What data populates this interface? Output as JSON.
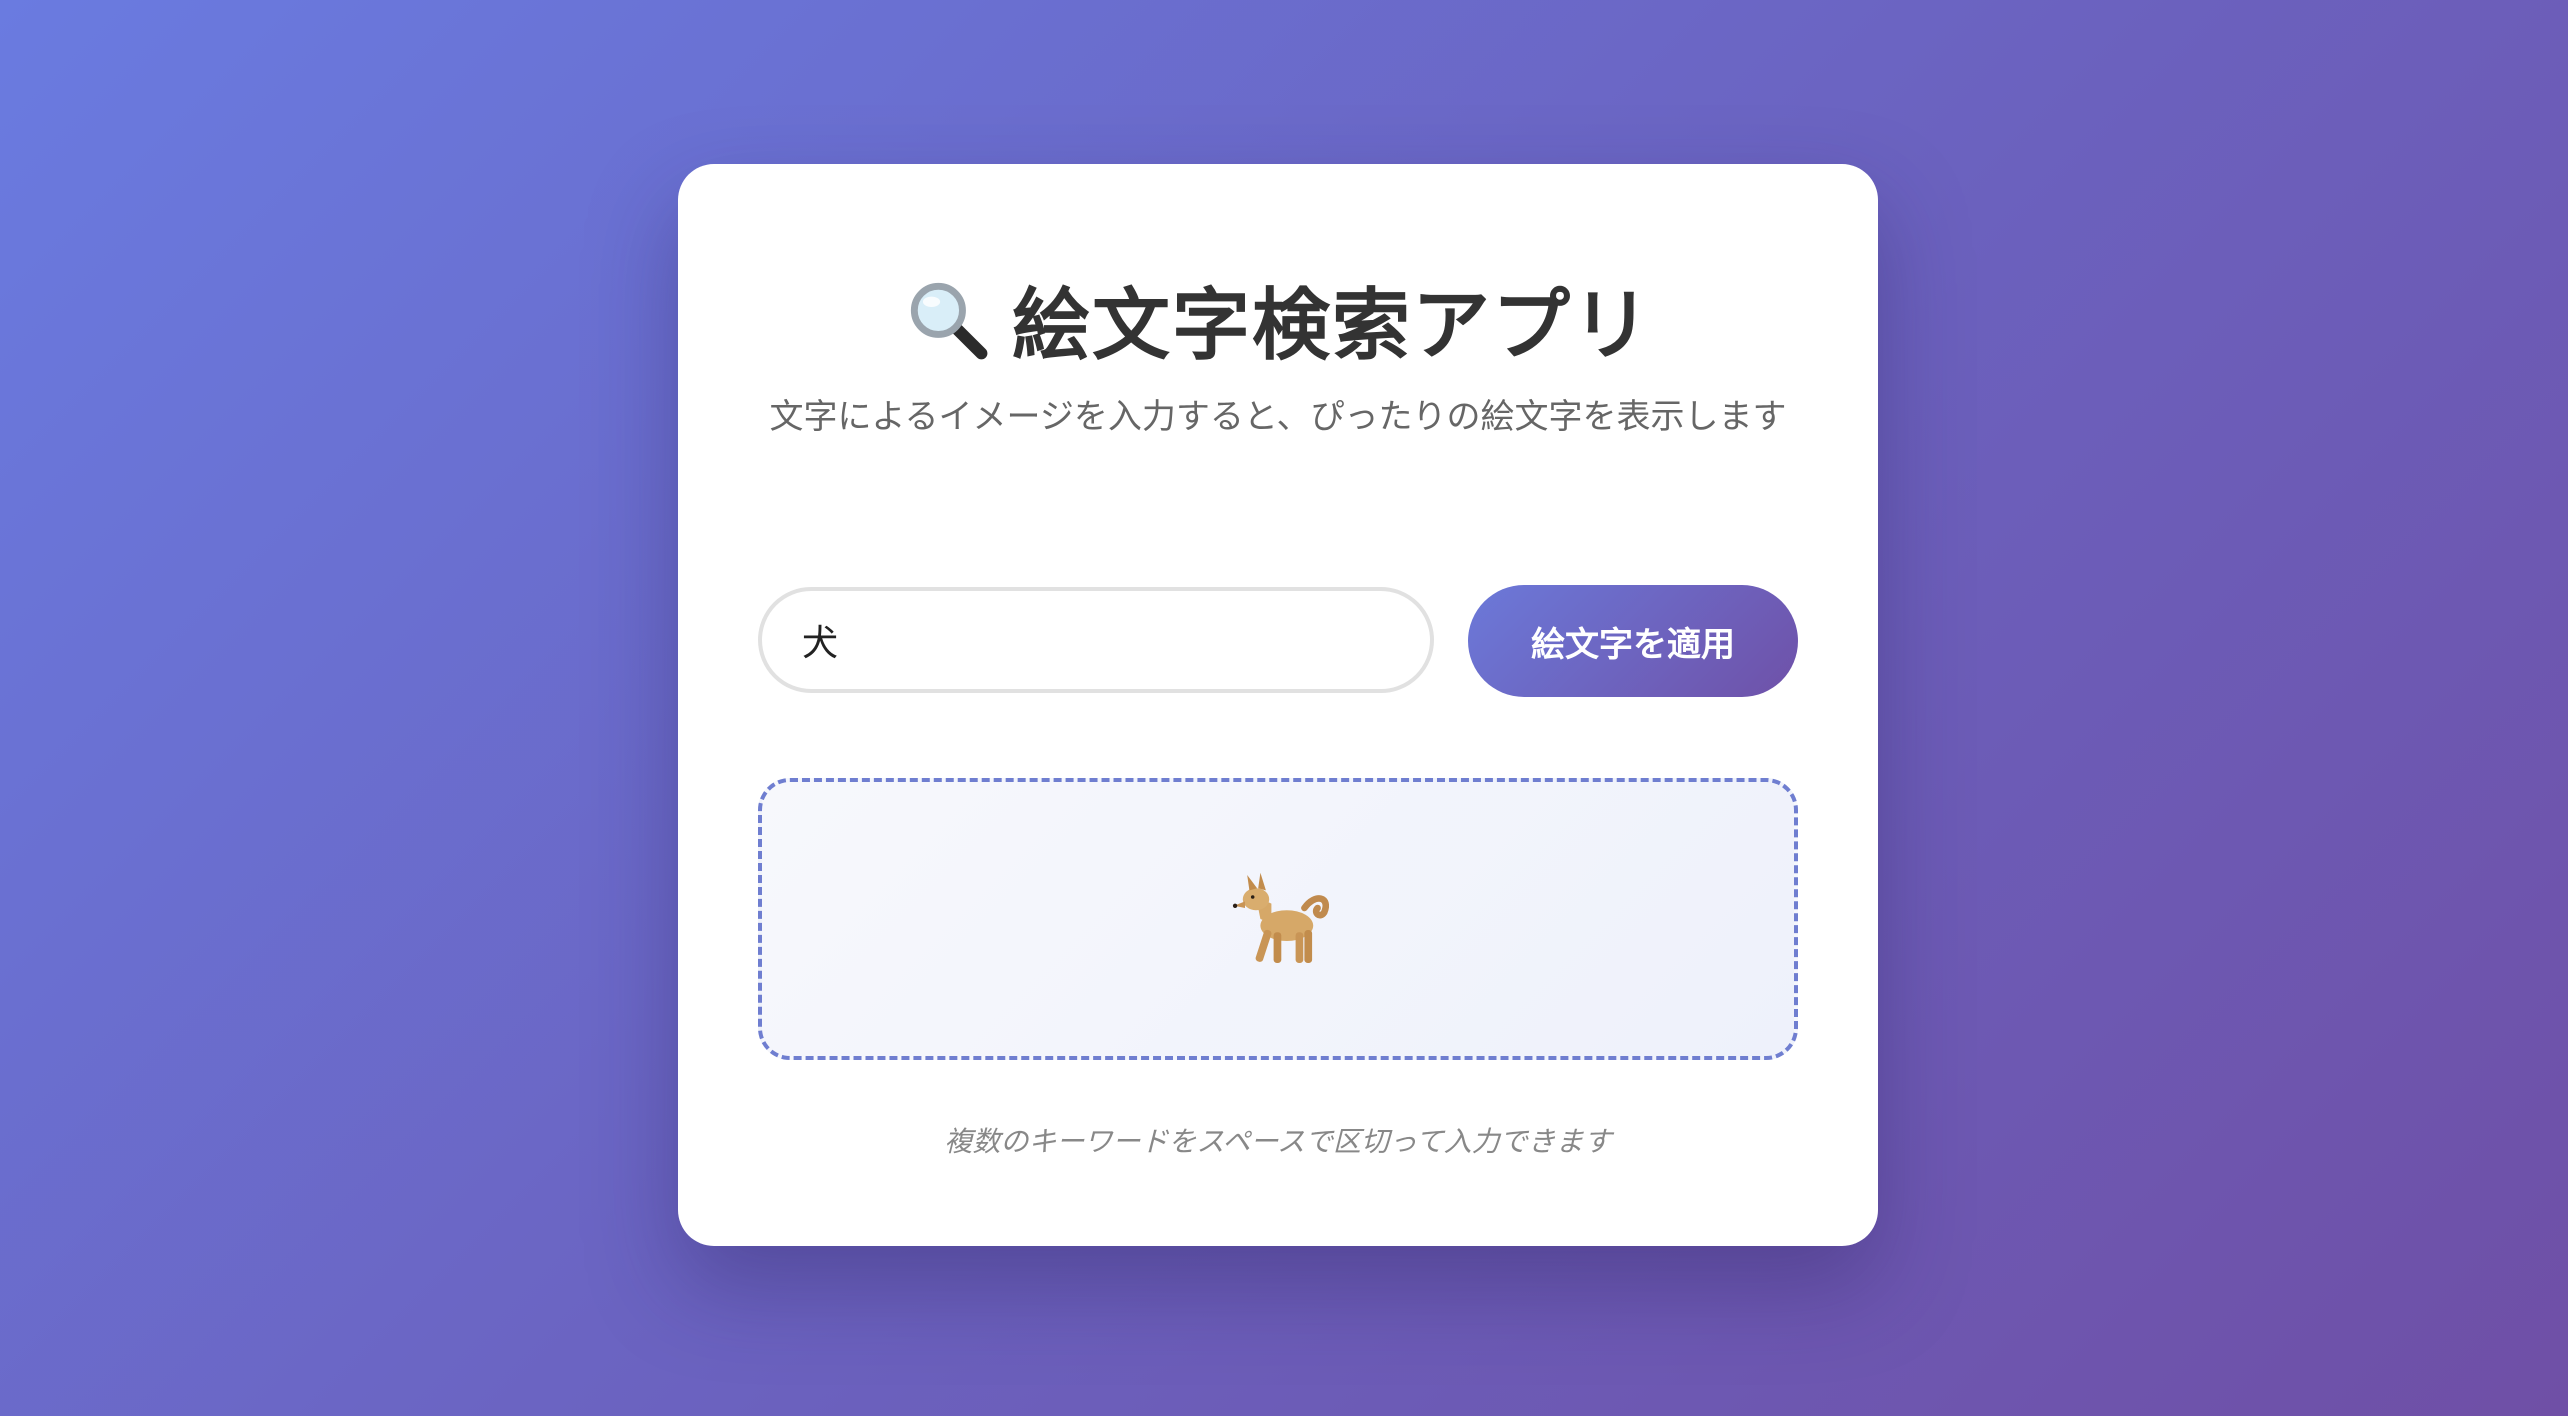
{
  "app": {
    "title": "絵文字検索アプリ",
    "title_icon": "magnifying-glass-icon",
    "subtitle": "文字によるイメージを入力すると、ぴったりの絵文字を表示します"
  },
  "search": {
    "value": "犬",
    "placeholder": ""
  },
  "apply_button": {
    "label": "絵文字を適用"
  },
  "result": {
    "emoji_icon": "dog-emoji"
  },
  "hint": "複数のキーワードをスペースで区切って入力できます",
  "colors": {
    "accent_start": "#6b79d9",
    "accent_end": "#6f51a8",
    "card_background": "#ffffff",
    "result_border": "#6f7ed0"
  }
}
